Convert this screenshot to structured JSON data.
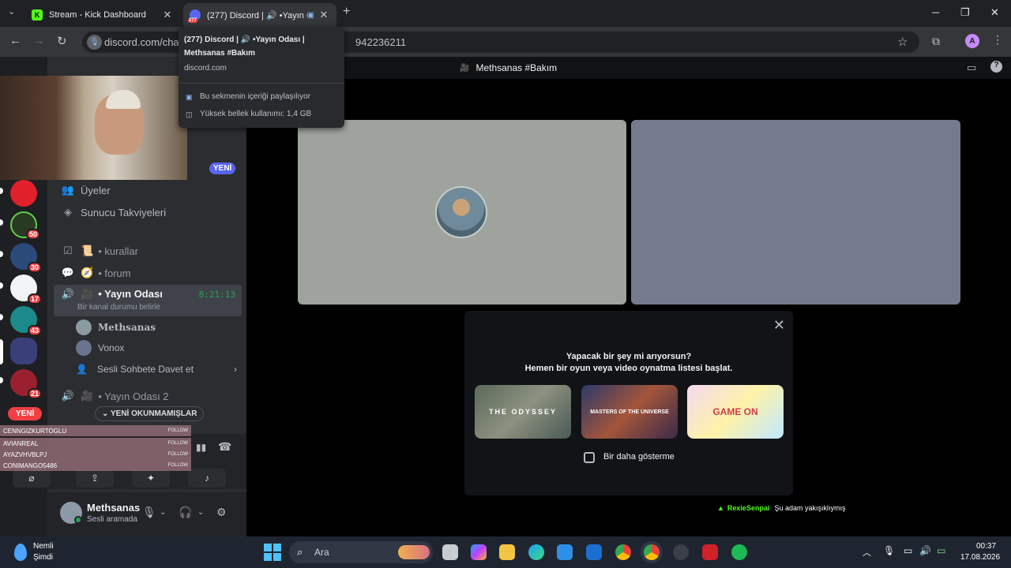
{
  "browser": {
    "tabs": [
      {
        "title": "Stream - Kick Dashboard",
        "favicon": "kick-icon",
        "active": false
      },
      {
        "title": "(277) Discord | 🔊 •Yayın Od",
        "favicon": "discord-icon",
        "badge": "277",
        "active": true
      }
    ],
    "url_left": "discord.com/chan",
    "url_right": "942236211",
    "account_initial": "A"
  },
  "tooltip": {
    "title_line1": "(277) Discord | 🔊 •Yayın Odası |",
    "title_line2": "Methsanas #Bakım",
    "domain": "discord.com",
    "info_sharing": "Bu sekmenin içeriği paylaşılıyor",
    "info_memory": "Yüksek bellek kullanımı: 1,4 GB"
  },
  "discord": {
    "guild_badges": [
      "50",
      "30",
      "17",
      "43",
      "21"
    ],
    "new_badge": "YENİ",
    "channels": {
      "members": "Üyeler",
      "boosts": "Sunucu Takviyeleri",
      "rules": "• kurallar",
      "forum": "• forum",
      "voice_active": "• Yayın Odası",
      "voice_active_timer": "8:21:13",
      "voice_active_status": "Bir kanal durumu belirle",
      "voice_members": [
        "Methsanas",
        "Vonox"
      ],
      "invite": "Sesli Sohbete Davet et",
      "voice_2": "• Yayın Odası 2"
    },
    "unread_pill": "YENİ OKUNMAMIŞLAR",
    "new_red": "YENİ",
    "user": {
      "name": "Methsanas",
      "status": "Sesli aramada"
    },
    "stage": {
      "title": "Methsanas #Bakım",
      "activity_line1": "Yapacak bir şey mi arıyorsun?",
      "activity_line2": "Hemen bir oyun veya video oynatma listesi başlat.",
      "games": [
        "THE ODYSSEY",
        "MASTERS OF THE UNIVERSE",
        "GAME ON"
      ],
      "dont_show_again": "Bir daha gösterme"
    }
  },
  "kick_alert": {
    "name": "RexieSenpai",
    "message": "Şu adam yakışıklıymış"
  },
  "follow_overlay": {
    "rows": [
      {
        "name": "CENNGIZKURTOGLU",
        "tag": "FOLLOW"
      },
      {
        "name": "AVIANREAL",
        "tag": "FOLLOW"
      },
      {
        "name": "AYAZVHVBLPJ",
        "tag": "FOLLOW"
      },
      {
        "name": "CONIMANGO5486",
        "tag": "FOLLOW"
      }
    ]
  },
  "taskbar": {
    "weather_line1": "Nemli",
    "weather_line2": "Şimdi",
    "search_placeholder": "Ara",
    "time": "00:37",
    "date": "17.08.2026"
  },
  "colors": {
    "discord_bg": "#2b2d31",
    "accent_blurple": "#5865f2",
    "badge_red": "#f23f43",
    "online_green": "#23a559",
    "kick_green": "#53fc18"
  }
}
